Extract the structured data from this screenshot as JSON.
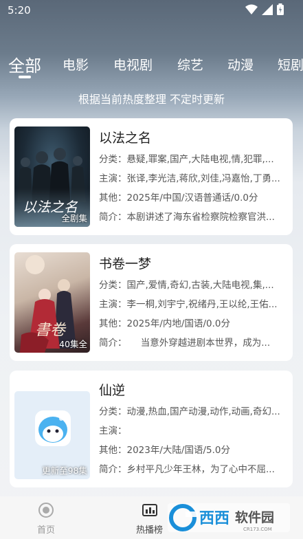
{
  "status": {
    "time": "5:20"
  },
  "tabs": [
    "全部",
    "电影",
    "电视剧",
    "综艺",
    "动漫",
    "短剧"
  ],
  "subtitle": "根据当前热度整理 不定时更新",
  "labels": {
    "category": "分类：",
    "cast": "主演：",
    "other": "其他：",
    "intro": "简介："
  },
  "items": [
    {
      "title": "以法之名",
      "badge": "全剧集",
      "category": "悬疑,罪案,国产,大陆电视,情,犯罪,...",
      "cast": "张译,李光洁,蒋欣,刘佳,冯嘉怡,丁勇...",
      "other": "2025年/中国/汉语普通话/0.0分",
      "intro": "本剧讲述了海东省检察院检察官洪...",
      "poster_text": "以法之名"
    },
    {
      "title": "书卷一梦",
      "badge": "40集全",
      "category": "国产,爱情,奇幻,古装,大陆电视,集,...",
      "cast": "李一桐,刘宇宁,祝绪丹,王以纶,王佑...",
      "other": "2025年/内地/国语/0.0分",
      "intro": "　　当意外穿越进剧本世界，成为...",
      "poster_text": "書卷"
    },
    {
      "title": "仙逆",
      "badge": "更新至98集",
      "category": "动漫,热血,国产动漫,动作,动画,奇幻...",
      "cast": "",
      "other": "2023年/大陆/国语/5.0分",
      "intro": "乡村平凡少年王林，为了心中不屈..."
    }
  ],
  "bottom_nav": {
    "home": "首页",
    "ranking": "热播榜"
  },
  "watermark": {
    "brand": "西西",
    "text": "软件园",
    "sub": "CR173.COM"
  },
  "colors": {
    "tab_text": "#ffffff",
    "card_bg": "#ffffff",
    "brand_blue": "#1a8fd9"
  }
}
